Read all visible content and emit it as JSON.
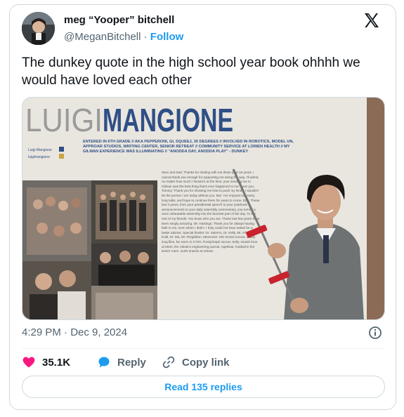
{
  "tweet": {
    "display_name": "meg “Yooper” bitchell",
    "handle": "@MeganBitchell",
    "separator": "·",
    "follow_label": "Follow",
    "text": "The dunkey quote in the high school year book ohhhh we would have loved each other",
    "timestamp": "4:29 PM · Dec 9, 2024"
  },
  "yearbook": {
    "name_first": "LUIGI",
    "name_last": "MANGIONE",
    "social_1": "Luigi Mangione",
    "social_2": "luigimangione",
    "bio": "ENTERED IN 6TH GRADE // AKA PEPPERONI, GI, SQUEEJ, 30 DEGREES // INVOLVED IN ROBOTICS, MODEL UN, APPROAR STUDIOS, WRITING CENTER, SENIOR RETREAT // COMMUNITY SERVICE AT LORIEN HEALTH // MY GILMAN EXPERIENCE WAS ILLUMINATING // \"ANODDA DAY, ANODDA PLAY\" - DUNKEY",
    "body_text": "Mom and Dad: Thanks for dealing with me these past 18 years. I cannot thank you enough for supporting me along the way. I'll admit, no matter how much I fussed it at the time, your sending me to Gilman was the best thing that's ever happened to me. Love you. Tommy: Thank you for showing me how to push my limits. I wouldn't be the person I am today without you. Bar: I've enjoyed our many long talks, and hope to continue them for years to come. Dan: These last 3 years, from your presidential speech to your yearbook announcements to your daily assembly commentary, you turned a once unbearable assembly into the funniest part of the day. To the rest of my friends: You know who you are. These last few years have been simply amazing. Mr. Hastings: Thank you for always having faith in me, even when I didn't. I truly could not have asked for a better advisor. Special thanks: Dr. Salerno, Dr. Kelly, Mr. Ahlgren, Dr. Krall, Dr. Ma, Mr. Fitzgibbon. Memories: MS recess soccer, daddy long files, far worm in CT20, Frosty/Soph soccer, Kelly, smash bros at MUN, the robotics engineering journal, AppRoar, football in the senior room, sushi snacks at retreat."
  },
  "stats": {
    "likes": "35.1K",
    "reply_label": "Reply",
    "copy_link_label": "Copy link"
  },
  "read_replies_label": "Read 135 replies",
  "colors": {
    "like": "#f91880",
    "accent": "#1d9bf0",
    "text": "#0f1419",
    "secondary": "#536471",
    "border": "#cfd9de"
  },
  "icons": [
    "x-logo-icon",
    "heart-icon",
    "reply-bubble-icon",
    "link-icon",
    "info-icon"
  ]
}
